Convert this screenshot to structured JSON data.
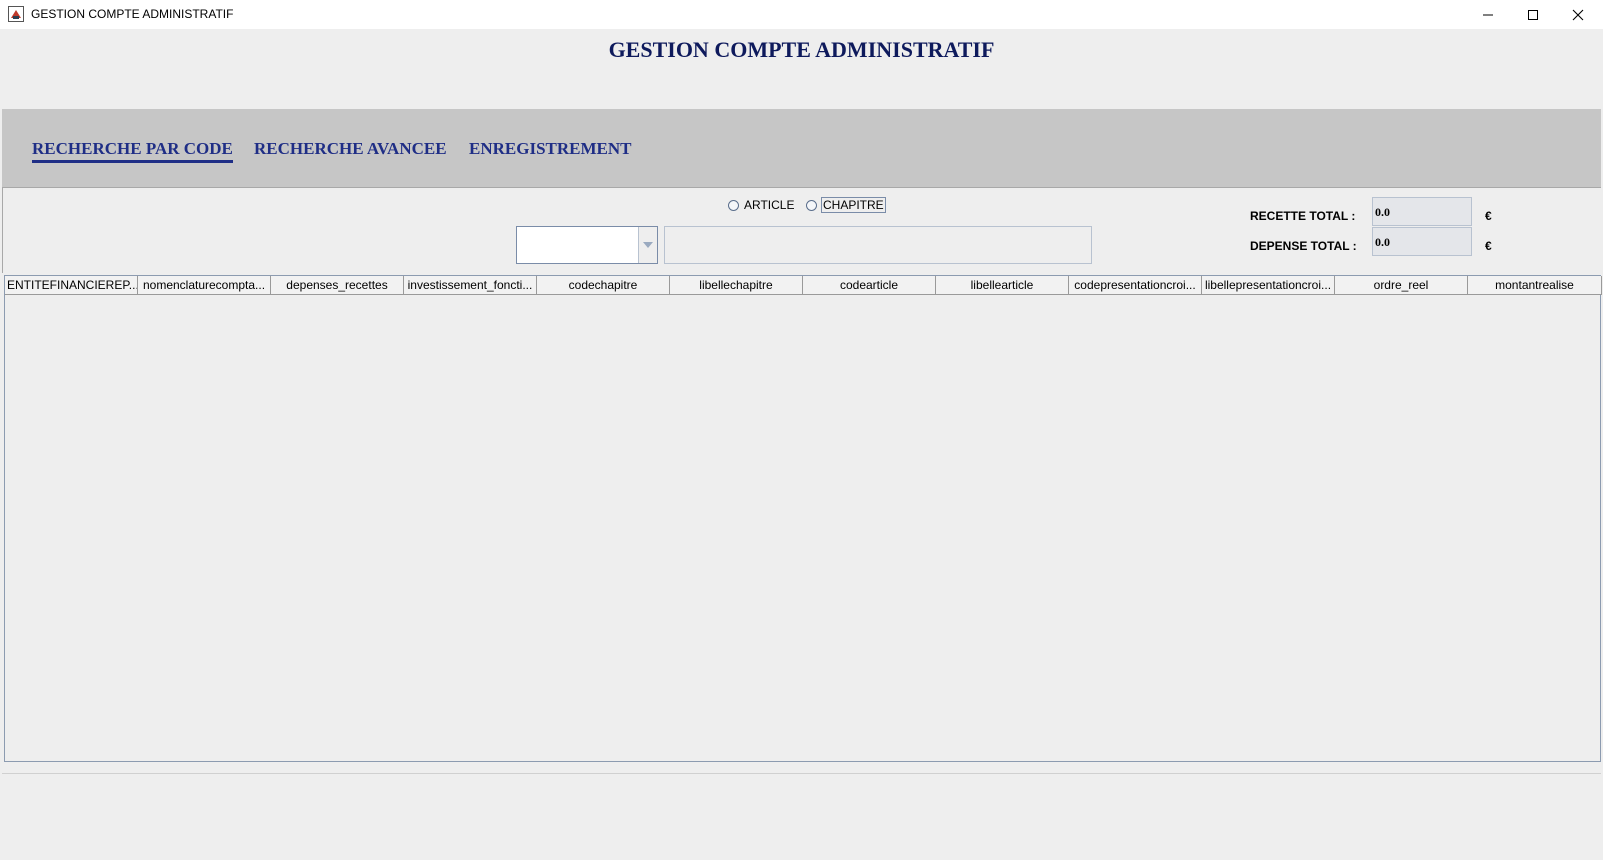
{
  "window": {
    "title": "GESTION COMPTE ADMINISTRATIF",
    "icon": "java-app-icon",
    "controls": [
      "minimize-icon",
      "maximize-icon",
      "close-icon"
    ]
  },
  "header": {
    "title": "GESTION COMPTE ADMINISTRATIF"
  },
  "tabs": [
    {
      "label": "RECHERCHE PAR CODE",
      "active": true
    },
    {
      "label": "RECHERCHE AVANCEE",
      "active": false
    },
    {
      "label": "ENREGISTREMENT",
      "active": false
    }
  ],
  "search": {
    "radio_article": "ARTICLE",
    "radio_chapitre": "CHAPITRE",
    "combo_value": "",
    "text_value": ""
  },
  "totals": {
    "recette_label": "RECETTE TOTAL :",
    "recette_value": "0.0",
    "depense_label": "DEPENSE TOTAL :",
    "depense_value": "0.0",
    "currency": "€"
  },
  "table": {
    "columns": [
      "ENTITEFINANCIEREP...",
      "nomenclaturecompta...",
      "depenses_recettes",
      "investissement_foncti...",
      "codechapitre",
      "libellechapitre",
      "codearticle",
      "libellearticle",
      "codepresentationcroi...",
      "libellepresentationcroi...",
      "ordre_reel",
      "montantrealise"
    ],
    "rows": []
  },
  "colors": {
    "title": "#0e1a5c",
    "tab_text": "#1f2e86",
    "tabbar_bg": "#c6c6c6",
    "panel_bg": "#eeeeee"
  }
}
